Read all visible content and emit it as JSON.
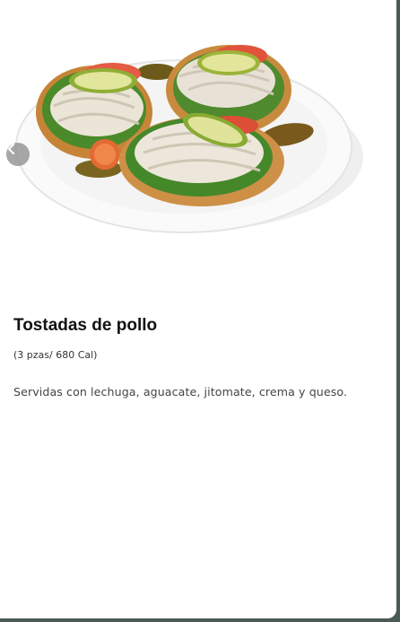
{
  "product": {
    "name": "Tostadas de pollo",
    "portion": "(3 pzas/ 680 Cal)",
    "description": "Servidas con lechuga, aguacate, jitomate, crema y queso."
  },
  "carousel": {
    "image_subject": "tostadas de pollo on white plate",
    "prev_icon": "chevron-left-icon"
  }
}
